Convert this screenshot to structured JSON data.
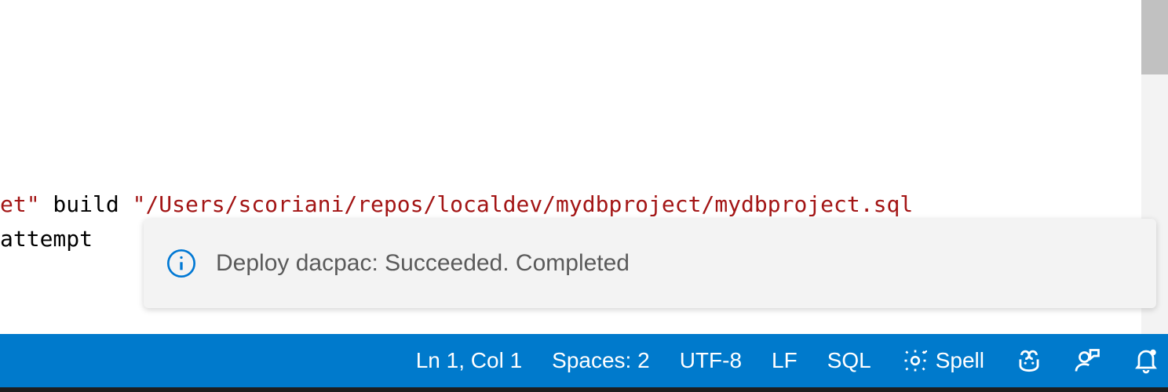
{
  "editor": {
    "line1_frag1": "et\"",
    "line1_frag2": "  build ",
    "line1_frag3": "\"/Users/scoriani/repos/localdev/mydbproject/mydbproject.sql",
    "line2_frag1": " attempt"
  },
  "notification": {
    "message": "Deploy dacpac: Succeeded. Completed"
  },
  "status_bar": {
    "cursor": "Ln 1, Col 1",
    "indent": "Spaces: 2",
    "encoding": "UTF-8",
    "eol": "LF",
    "language": "SQL",
    "spell_label": "Spell"
  }
}
